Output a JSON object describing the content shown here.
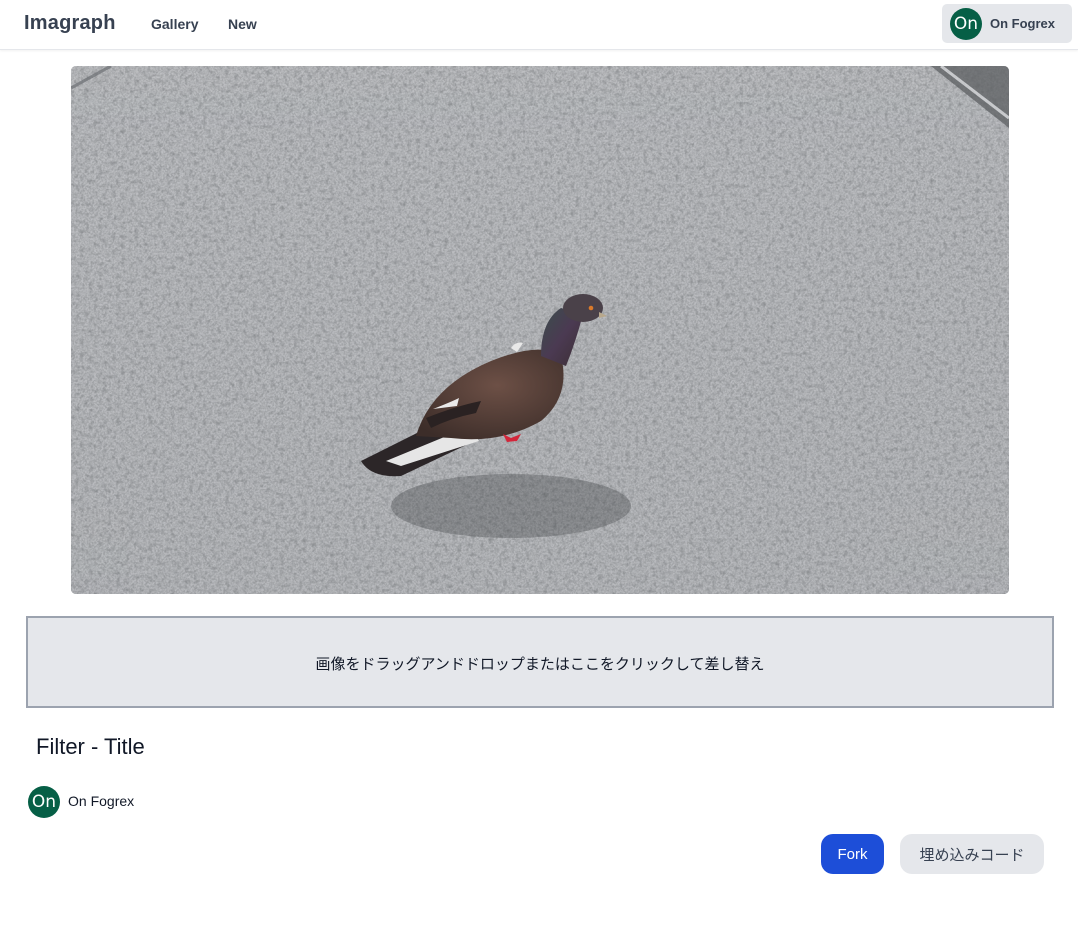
{
  "navbar": {
    "brand": "Imagraph",
    "links": [
      {
        "label": "Gallery"
      },
      {
        "label": "New"
      }
    ],
    "user": {
      "avatar_text": "On",
      "name": "On Fogrex",
      "avatar_color": "#065f46"
    }
  },
  "photo": {
    "subject": "pigeon on gravel pavement"
  },
  "dropzone": {
    "text": "画像をドラッグアンドドロップまたはここをクリックして差し替え"
  },
  "post": {
    "title": "Filter - Title",
    "author": {
      "avatar_text": "On",
      "name": "On Fogrex"
    }
  },
  "actions": {
    "fork_label": "Fork",
    "embed_label": "埋め込みコード"
  },
  "colors": {
    "primary_button": "#1d4ed8",
    "secondary_button": "#e5e7eb",
    "avatar": "#065f46",
    "dropzone_bg": "#e5e7eb",
    "dropzone_border": "#9ca3af"
  }
}
